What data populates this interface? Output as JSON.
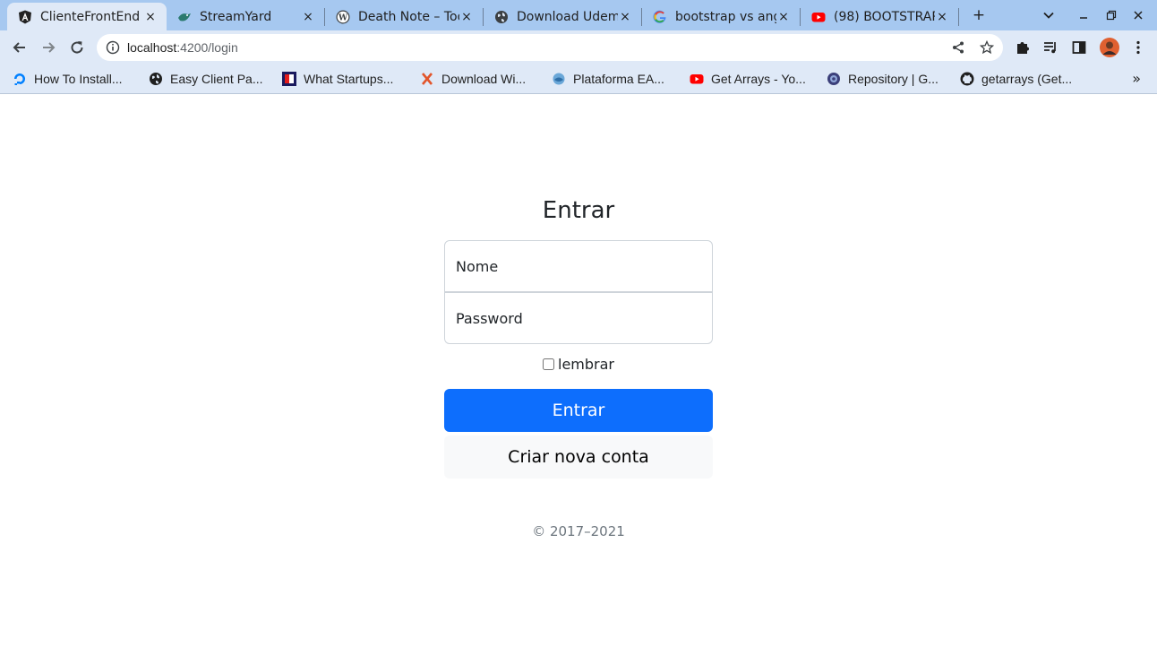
{
  "browser": {
    "tabs": [
      {
        "title": "ClienteFrontEnd",
        "icon": "angular-icon",
        "active": true
      },
      {
        "title": "StreamYard",
        "icon": "streamyard-icon",
        "active": false
      },
      {
        "title": "Death Note – Too",
        "icon": "wordpress-icon",
        "active": false
      },
      {
        "title": "Download Udem",
        "icon": "globe-icon",
        "active": false
      },
      {
        "title": "bootstrap vs ang",
        "icon": "google-icon",
        "active": false
      },
      {
        "title": "(98) BOOTSTRAP",
        "icon": "youtube-icon",
        "active": false
      }
    ],
    "new_tab_label": "+",
    "close_glyph": "×",
    "address": {
      "host": "localhost",
      "path": ":4200/login"
    },
    "bookmarks": [
      {
        "label": "How To Install...",
        "icon": "digitalocean-icon"
      },
      {
        "label": "Easy Client Pa...",
        "icon": "globe-icon"
      },
      {
        "label": "What Startups...",
        "icon": "startups-icon"
      },
      {
        "label": "Download Wi...",
        "icon": "x-icon"
      },
      {
        "label": "Plataforma EA...",
        "icon": "platform-icon"
      },
      {
        "label": "Get Arrays - Yo...",
        "icon": "youtube-icon"
      },
      {
        "label": "Repository | G...",
        "icon": "repository-icon"
      },
      {
        "label": "getarrays (Get...",
        "icon": "github-icon"
      }
    ],
    "bookmarks_more": "»"
  },
  "login": {
    "heading": "Entrar",
    "name_placeholder": "Nome",
    "password_placeholder": "Password",
    "remember_label": "lembrar",
    "submit_label": "Entrar",
    "register_label": "Criar nova conta",
    "copyright": "© 2017–2021"
  },
  "colors": {
    "primary": "#0d6efd",
    "tabstrip": "#a6c8f0",
    "toolbar": "#dfe9f7"
  }
}
